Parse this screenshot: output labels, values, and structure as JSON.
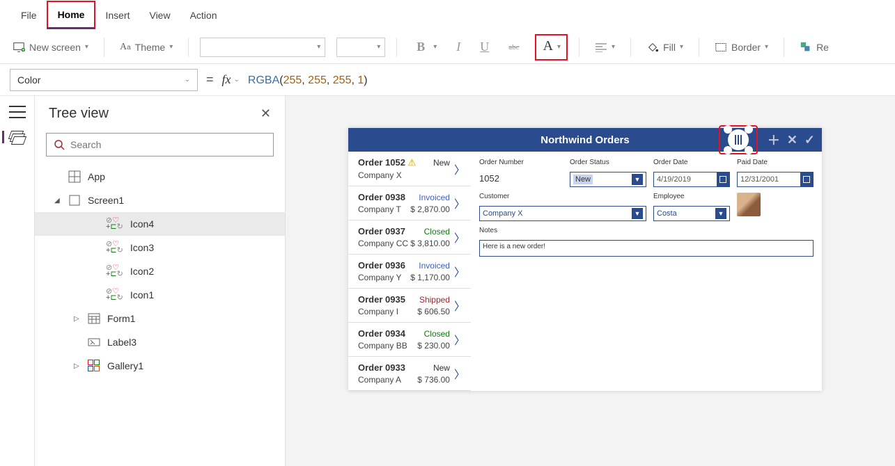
{
  "menubar": {
    "file": "File",
    "home": "Home",
    "insert": "Insert",
    "view": "View",
    "action": "Action"
  },
  "toolbar": {
    "new_screen": "New screen",
    "theme": "Theme",
    "fill": "Fill",
    "border": "Border",
    "reorder": "Re"
  },
  "formula": {
    "property": "Color",
    "fx": "fx",
    "fn_name": "RGBA",
    "args": [
      "255",
      "255",
      "255",
      "1"
    ]
  },
  "tree": {
    "title": "Tree view",
    "search_placeholder": "Search",
    "app": "App",
    "screen": "Screen1",
    "icons": [
      "Icon4",
      "Icon3",
      "Icon2",
      "Icon1"
    ],
    "form": "Form1",
    "label": "Label3",
    "gallery": "Gallery1"
  },
  "app": {
    "title": "Northwind Orders",
    "orders": [
      {
        "id": "Order 1052",
        "company": "Company X",
        "status": "New",
        "status_class": "st-new",
        "amount": "",
        "warn": true
      },
      {
        "id": "Order 0938",
        "company": "Company T",
        "status": "Invoiced",
        "status_class": "st-invoiced",
        "amount": "$ 2,870.00"
      },
      {
        "id": "Order 0937",
        "company": "Company CC",
        "status": "Closed",
        "status_class": "st-closed",
        "amount": "$ 3,810.00"
      },
      {
        "id": "Order 0936",
        "company": "Company Y",
        "status": "Invoiced",
        "status_class": "st-invoiced",
        "amount": "$ 1,170.00"
      },
      {
        "id": "Order 0935",
        "company": "Company I",
        "status": "Shipped",
        "status_class": "st-shipped",
        "amount": "$ 606.50"
      },
      {
        "id": "Order 0934",
        "company": "Company BB",
        "status": "Closed",
        "status_class": "st-closed",
        "amount": "$ 230.00"
      },
      {
        "id": "Order 0933",
        "company": "Company A",
        "status": "New",
        "status_class": "st-new",
        "amount": "$ 736.00"
      }
    ],
    "form": {
      "order_number_label": "Order Number",
      "order_number": "1052",
      "order_status_label": "Order Status",
      "order_status": "New",
      "order_date_label": "Order Date",
      "order_date": "4/19/2019",
      "paid_date_label": "Paid Date",
      "paid_date": "12/31/2001",
      "customer_label": "Customer",
      "customer": "Company X",
      "employee_label": "Employee",
      "employee": "Costa",
      "notes_label": "Notes",
      "notes": "Here is a new order!"
    }
  }
}
